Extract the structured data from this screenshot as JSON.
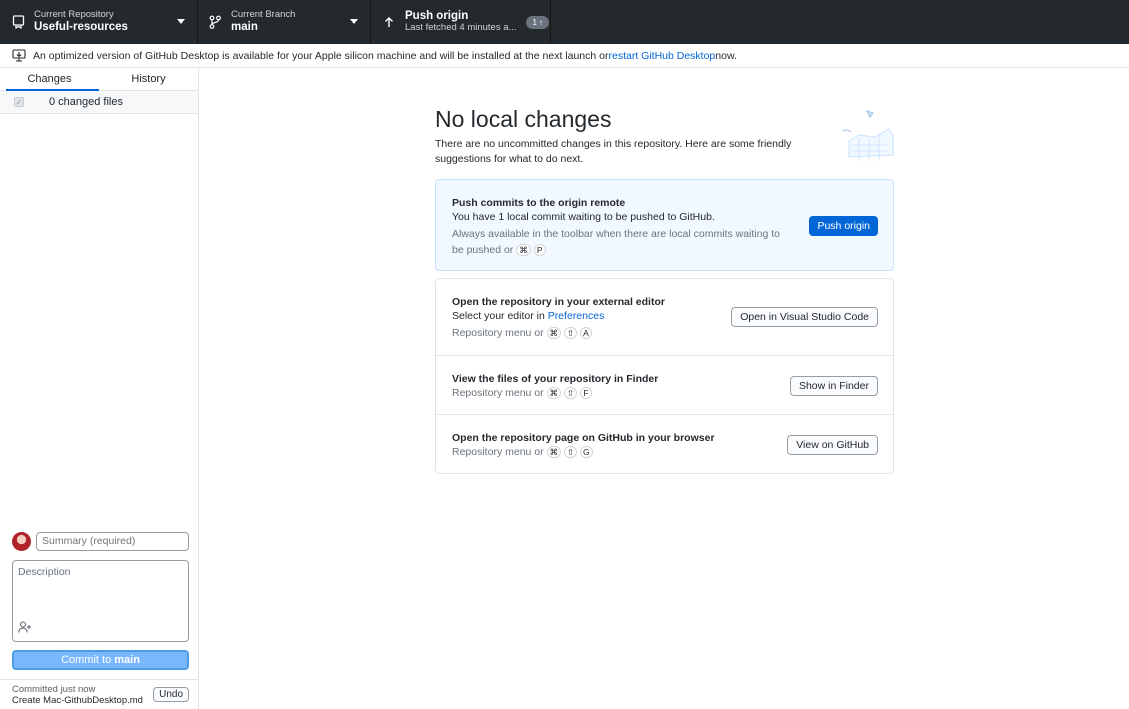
{
  "toolbar": {
    "repository": {
      "label": "Current Repository",
      "value": "Useful-resources"
    },
    "branch": {
      "label": "Current Branch",
      "value": "main"
    },
    "push": {
      "label": "Push origin",
      "status": "Last fetched 4 minutes a...",
      "badge_count": "1",
      "badge_arrow": "↑"
    }
  },
  "banner": {
    "text_before": "An optimized version of GitHub Desktop is available for your Apple silicon machine and will be installed at the next launch or ",
    "link": "restart GitHub Desktop",
    "text_after": " now."
  },
  "sidebar": {
    "tabs": [
      {
        "label": "Changes"
      },
      {
        "label": "History"
      }
    ],
    "changed_files": "0 changed files",
    "summary_placeholder": "Summary (required)",
    "description_placeholder": "Description",
    "commit_button": {
      "prefix": "Commit to ",
      "branch": "main"
    },
    "last_commit": {
      "time": "Committed just now",
      "message": "Create Mac-GithubDesktop.md",
      "undo": "Undo"
    }
  },
  "main": {
    "title": "No local changes",
    "subtitle": "There are no uncommitted changes in this repository. Here are some friendly suggestions for what to do next.",
    "push_card": {
      "title": "Push commits to the origin remote",
      "description": "You have 1 local commit waiting to be pushed to GitHub.",
      "hint": "Always available in the toolbar when there are local commits waiting to be pushed or",
      "keys": [
        "⌘",
        "P"
      ],
      "button": "Push origin"
    },
    "editor_card": {
      "title": "Open the repository in your external editor",
      "description_prefix": "Select your editor in ",
      "link": "Preferences",
      "hint": "Repository menu or",
      "keys": [
        "⌘",
        "⇧",
        "A"
      ],
      "button": "Open in Visual Studio Code"
    },
    "finder_card": {
      "title": "View the files of your repository in Finder",
      "hint": "Repository menu or",
      "keys": [
        "⌘",
        "⇧",
        "F"
      ],
      "button": "Show in Finder"
    },
    "github_card": {
      "title": "Open the repository page on GitHub in your browser",
      "hint": "Repository menu or",
      "keys": [
        "⌘",
        "⇧",
        "G"
      ],
      "button": "View on GitHub"
    }
  },
  "colors": {
    "toolbar_bg": "#24292e",
    "accent": "#0366d6",
    "commit_button": "#79b8ff",
    "push_card_bg": "#f1f8ff"
  }
}
